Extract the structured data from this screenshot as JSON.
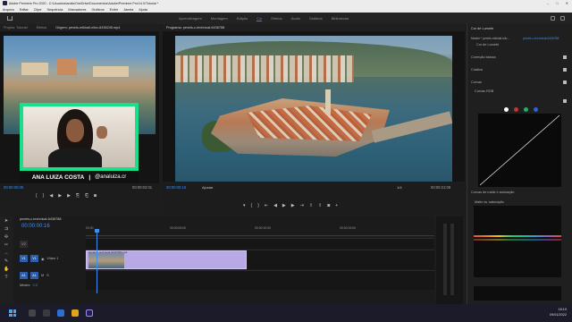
{
  "window": {
    "title": "Adobe Premiere Pro 2020 - C:\\Usuarios\\anals\\OneDrive\\Documentos\\Adobe\\Premiere Pro\\14.0\\Tutorial *"
  },
  "menu": [
    "Arquivo",
    "Editar",
    "Clipe",
    "Sequência",
    "Marcadores",
    "Gráficos",
    "Exibir",
    "Janela",
    "Ajuda"
  ],
  "workspaces": {
    "tabs": [
      "Aprendizagem",
      "Montagem",
      "Edição",
      "Cor",
      "Efeitos",
      "Áudio",
      "Gráficos",
      "Bibliotecas"
    ],
    "active": "Cor"
  },
  "left_panel_tabs": [
    "Projeto: Tutorial",
    "Efeitos",
    "Origem: pexels-mikhail-nilov-8436245.mp4"
  ],
  "source_monitor": {
    "timecode_left": "00:00:00:00",
    "timecode_right": "00:00:02:01",
    "overlay_name": "ANA LUIZA COSTA",
    "overlay_separator": "|",
    "overlay_handle": "@analuiza.cr"
  },
  "program_monitor": {
    "tab": "Programa: pexels-c-technical-6436788",
    "timecode_left": "00:00:00:16",
    "fit": "Ajustar",
    "fraction": "1/4",
    "timecode_right": "00:00:21:08"
  },
  "lumetri": {
    "tab": "Cor de Lumetri",
    "master_label": "Mestre * pexels-mikhail-nilo...",
    "seq_label": "pexels-c-technical-6436788",
    "fx_name": "Cor de Lumetri",
    "sections": [
      "Correção básica",
      "Criativa",
      "Curvas"
    ],
    "curves_rgb": "Curvas RGB",
    "hue_sat": "Curvas de matiz e saturação",
    "hue_vs_sat": "Matiz vs. saturação",
    "hue_vs_hue": "Matiz vs. matiz"
  },
  "timeline": {
    "tab": "pexels-c-technical-6436788",
    "timecode": "00:00:00:16",
    "ruler": [
      "00:00",
      "00:00:05:00",
      "00:00:10:00",
      "00:00:15:00"
    ],
    "tracks_video": [
      "V3",
      "V2",
      "V1"
    ],
    "tracks_audio": [
      "A1",
      "A2",
      "A3"
    ],
    "v1_label": "Vídeo 1",
    "a1_label": "A1",
    "clip_name": "pexels-c-technical-6436788.mp4",
    "master": "Mestre",
    "master_value": "0,0"
  },
  "taskbar": {
    "time": "18:19",
    "date": "09/01/2022"
  },
  "colors": {
    "accent_blue": "#3d8ff0",
    "webcam_frame": "#18e08a",
    "clip": "#b9a8e6"
  }
}
